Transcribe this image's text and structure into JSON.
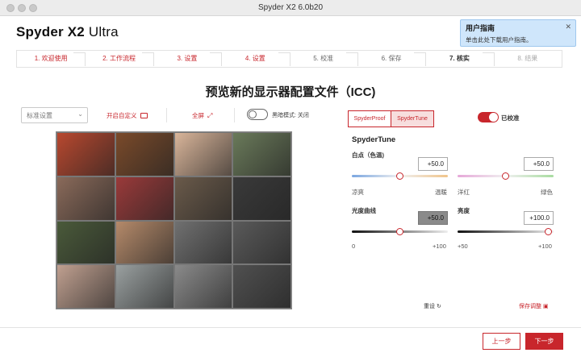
{
  "window": {
    "title": "Spyder X2 6.0b20"
  },
  "app": {
    "name_bold": "Spyder X2",
    "name_rest": "Ultra"
  },
  "guide": {
    "title": "用户指南",
    "desc": "单击此处下载用户指南。",
    "close": "✕"
  },
  "steps": [
    {
      "label": "1. 欢迎使用",
      "state": "done"
    },
    {
      "label": "2. 工作流程",
      "state": "done"
    },
    {
      "label": "3. 设置",
      "state": "done"
    },
    {
      "label": "4. 设置",
      "state": "done"
    },
    {
      "label": "5. 校准",
      "state": "next"
    },
    {
      "label": "6. 保存",
      "state": "next"
    },
    {
      "label": "7. 核实",
      "state": "bold"
    },
    {
      "label": "8. 结果",
      "state": "off"
    }
  ],
  "page_title": "预览新的显示器配置文件（ICC)",
  "left": {
    "preset_placeholder": "标准设置",
    "custom_label": "开启自定义",
    "full_label": "全屏",
    "dark_mode": "黑暗模式: 关闭"
  },
  "right": {
    "tabs": [
      "SpyderProof",
      "SpyderTune"
    ],
    "calibrated_label": "已校准",
    "section_title": "SpyderTune",
    "white_point": {
      "label": "白点（色温)",
      "value": "+50.0",
      "min": "凉爽",
      "max": "温暖",
      "level": 0.5
    },
    "tint": {
      "value": "+50.0",
      "min": "洋红",
      "max": "绿色",
      "level": 0.5
    },
    "tone_curve": {
      "label": "光度曲线",
      "value": "+50.0",
      "min": "0",
      "max": "+100",
      "level": 0.5
    },
    "brightness": {
      "label": "亮度",
      "value": "+100.0",
      "min": "+50",
      "max": "+100",
      "level": 1.0
    },
    "reset_label": "重设",
    "save_label": "保存调整"
  },
  "buttons": {
    "prev": "上一步",
    "next": "下一步"
  },
  "colors": {
    "accent": "#c8262c",
    "guide_bg": "#cfe6fb"
  },
  "images": [
    "#b8482f",
    "#7a4a2a",
    "#d9b59a",
    "#6a7a5a",
    "#8a6a5a",
    "#9a3a3a",
    "#6a5a4a",
    "#3a3a3a",
    "#4a5a3a",
    "#b58a6a",
    "#707070",
    "#5a5a5a",
    "#c0a090",
    "#9aa0a0",
    "#8a8a8a",
    "#505050"
  ]
}
